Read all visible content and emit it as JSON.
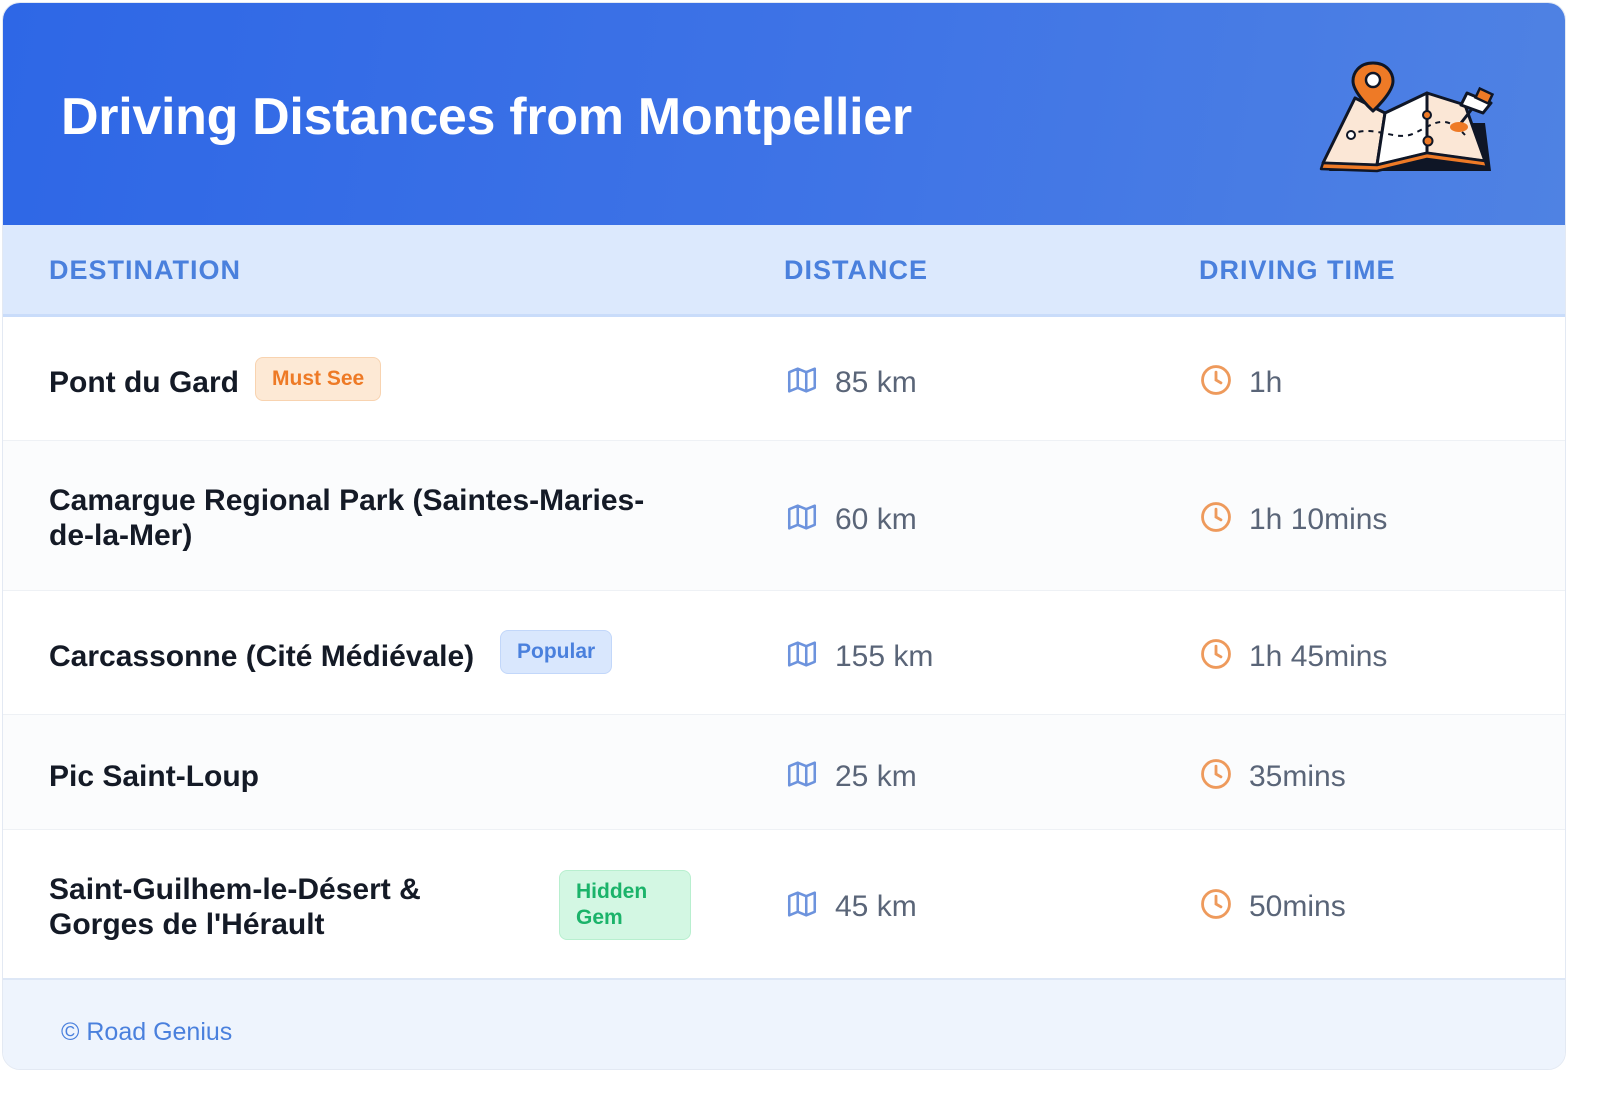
{
  "header": {
    "title": "Driving Distances from Montpellier",
    "illustration_icon": "folded-map-with-pins-icon"
  },
  "columns": {
    "destination": "DESTINATION",
    "distance": "DISTANCE",
    "driving_time": "DRIVING TIME"
  },
  "rows": [
    {
      "destination": "Pont du Gard",
      "badge": "Must See",
      "badge_color": "#ee7a26",
      "distance": "85 km",
      "time": "1h"
    },
    {
      "destination": "Camargue Regional Park (Saintes-Maries-de-la-Mer)",
      "badge": "",
      "badge_color": "",
      "distance": "60 km",
      "time": "1h 10mins"
    },
    {
      "destination": "Carcassonne (Cité Médiévale)",
      "badge": "Popular",
      "badge_color": "#4a80dd",
      "distance": "155 km",
      "time": "1h 45mins"
    },
    {
      "destination": "Pic Saint-Loup",
      "badge": "",
      "badge_color": "",
      "distance": "25 km",
      "time": "35mins"
    },
    {
      "destination": "Saint-Guilhem-le-Désert & Gorges de l'Hérault",
      "badge": "Hidden Gem",
      "badge_color": "#1bb36a",
      "distance": "45 km",
      "time": "50mins"
    }
  ],
  "icons": {
    "distance": "map-icon",
    "time": "clock-icon"
  },
  "colors": {
    "header_blue": "#2e67e6",
    "accent_orange": "#ee7a26",
    "column_header_text": "#4a80dd"
  },
  "footer": {
    "copyright": "© Road Genius"
  }
}
